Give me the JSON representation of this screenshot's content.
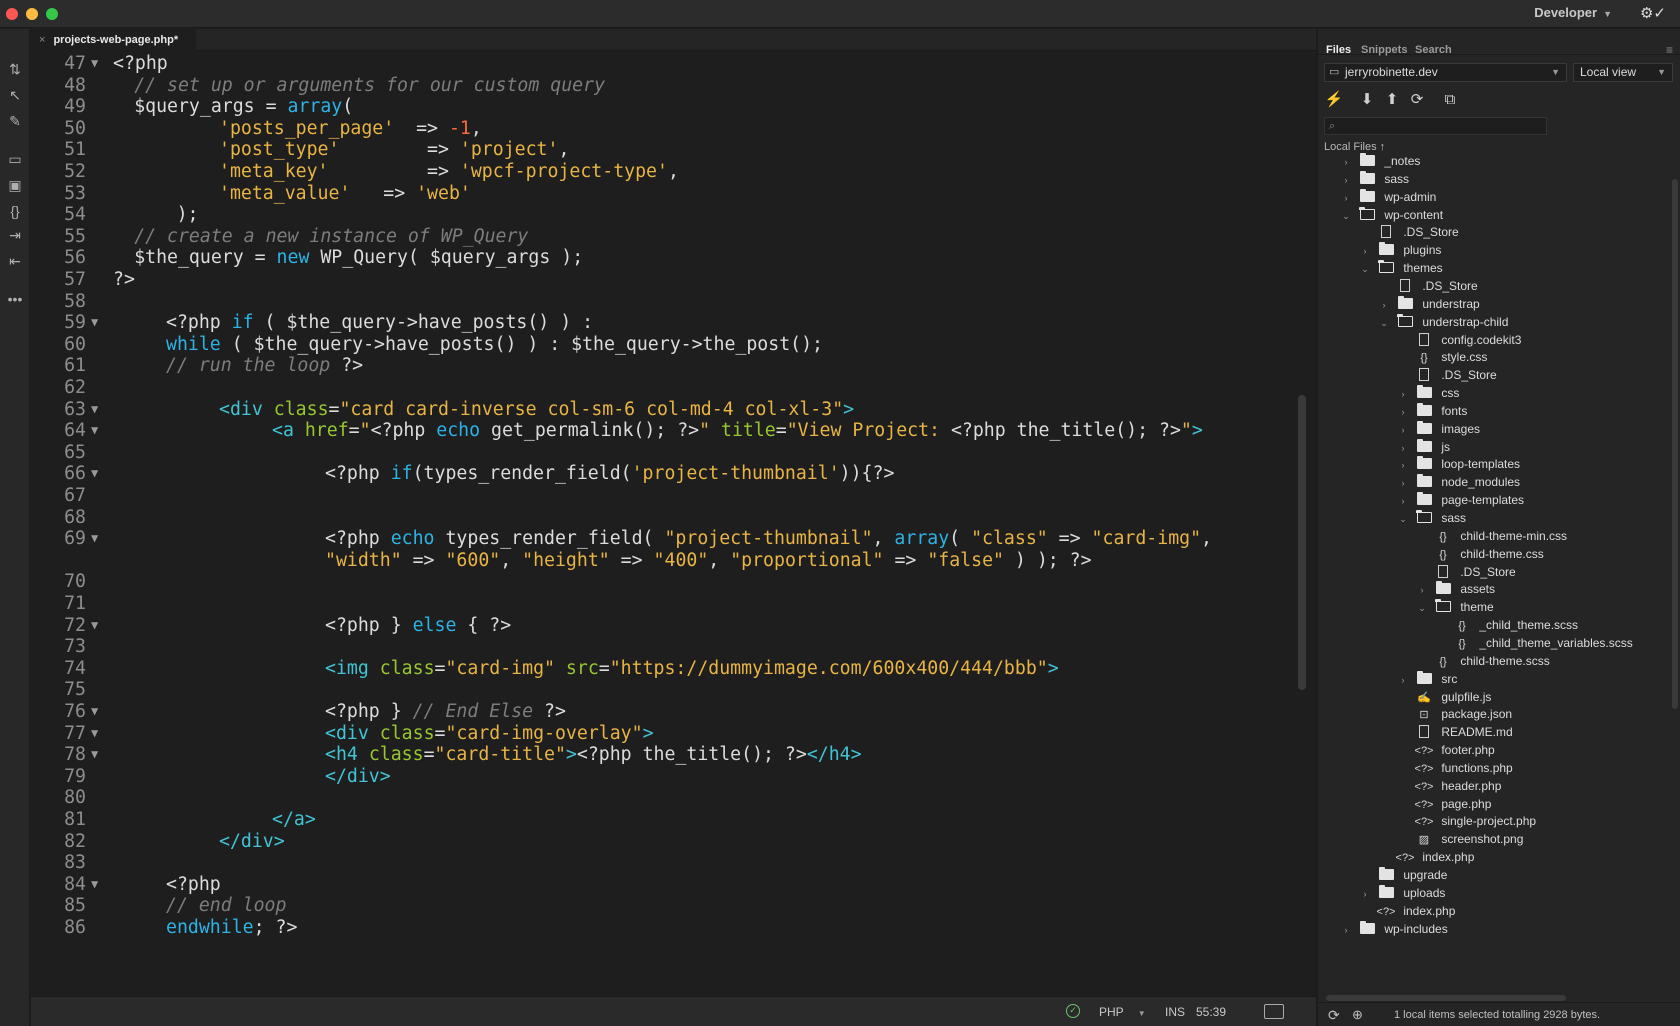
{
  "window": {
    "workspace": "Developer"
  },
  "editor": {
    "tab_title": "projects-web-page.php*",
    "lines": [
      {
        "n": "47",
        "fold": "▼",
        "indent": 0,
        "tokens": [
          [
            "",
            "<?php"
          ]
        ]
      },
      {
        "n": "48",
        "fold": "",
        "indent": 2,
        "tokens": [
          [
            "cm",
            "// set up or arguments for our custom query"
          ]
        ]
      },
      {
        "n": "49",
        "fold": "",
        "indent": 2,
        "tokens": [
          [
            "",
            "$query_args = "
          ],
          [
            "kw",
            "array"
          ],
          [
            "",
            "("
          ]
        ]
      },
      {
        "n": "50",
        "fold": "",
        "indent": 10,
        "tokens": [
          [
            "str",
            "'posts_per_page'"
          ],
          [
            "",
            "  => "
          ],
          [
            "num",
            "-1"
          ],
          [
            "",
            ","
          ]
        ]
      },
      {
        "n": "51",
        "fold": "",
        "indent": 10,
        "tokens": [
          [
            "str",
            "'post_type'"
          ],
          [
            "",
            "        => "
          ],
          [
            "str",
            "'project'"
          ],
          [
            "",
            ","
          ]
        ]
      },
      {
        "n": "52",
        "fold": "",
        "indent": 10,
        "tokens": [
          [
            "str",
            "'meta_key'"
          ],
          [
            "",
            "         => "
          ],
          [
            "str",
            "'wpcf-project-type'"
          ],
          [
            "",
            ","
          ]
        ]
      },
      {
        "n": "53",
        "fold": "",
        "indent": 10,
        "tokens": [
          [
            "str",
            "'meta_value'"
          ],
          [
            "",
            "   => "
          ],
          [
            "str",
            "'web'"
          ]
        ]
      },
      {
        "n": "54",
        "fold": "",
        "indent": 6,
        "tokens": [
          [
            "",
            ");"
          ]
        ]
      },
      {
        "n": "55",
        "fold": "",
        "indent": 2,
        "tokens": [
          [
            "cm",
            "// create a new instance of WP_Query"
          ]
        ]
      },
      {
        "n": "56",
        "fold": "",
        "indent": 2,
        "tokens": [
          [
            "",
            "$the_query = "
          ],
          [
            "kw",
            "new"
          ],
          [
            "",
            " WP_Query( $query_args );"
          ]
        ]
      },
      {
        "n": "57",
        "fold": "",
        "indent": 0,
        "tokens": [
          [
            "",
            "?>"
          ]
        ]
      },
      {
        "n": "58",
        "fold": "",
        "indent": 0,
        "tokens": []
      },
      {
        "n": "59",
        "fold": "▼",
        "indent": 5,
        "tokens": [
          [
            "",
            "<?php "
          ],
          [
            "kw",
            "if"
          ],
          [
            "",
            " ( $the_query->have_posts() ) :"
          ]
        ]
      },
      {
        "n": "60",
        "fold": "",
        "indent": 5,
        "tokens": [
          [
            "kw",
            "while"
          ],
          [
            "",
            " ( $the_query->have_posts() ) : $the_query->the_post();"
          ]
        ]
      },
      {
        "n": "61",
        "fold": "",
        "indent": 5,
        "tokens": [
          [
            "cm",
            "// run the loop"
          ],
          [
            "",
            " ?>"
          ]
        ]
      },
      {
        "n": "62",
        "fold": "",
        "indent": 0,
        "tokens": []
      },
      {
        "n": "63",
        "fold": "▼",
        "indent": 10,
        "tokens": [
          [
            "tag",
            "<div"
          ],
          [
            "",
            " "
          ],
          [
            "attr",
            "class"
          ],
          [
            "",
            "="
          ],
          [
            "str",
            "\"card card-inverse col-sm-6 col-md-4 col-xl-3\""
          ],
          [
            "tag",
            ">"
          ]
        ]
      },
      {
        "n": "64",
        "fold": "▼",
        "indent": 15,
        "tokens": [
          [
            "tag",
            "<a"
          ],
          [
            "",
            " "
          ],
          [
            "attr",
            "href"
          ],
          [
            "",
            "="
          ],
          [
            "str",
            "\""
          ],
          [
            "",
            "<?php "
          ],
          [
            "kw",
            "echo"
          ],
          [
            "",
            " get_permalink(); ?>"
          ],
          [
            "str",
            "\""
          ],
          [
            "",
            " "
          ],
          [
            "attr",
            "title"
          ],
          [
            "",
            "="
          ],
          [
            "str",
            "\"View Project: "
          ],
          [
            "",
            "<?php the_title(); ?>"
          ],
          [
            "str",
            "\""
          ],
          [
            "tag",
            ">"
          ]
        ]
      },
      {
        "n": "65",
        "fold": "",
        "indent": 0,
        "tokens": []
      },
      {
        "n": "66",
        "fold": "▼",
        "indent": 20,
        "tokens": [
          [
            "",
            "<?php "
          ],
          [
            "kw",
            "if"
          ],
          [
            "",
            "(types_render_field("
          ],
          [
            "str",
            "'project-thumbnail'"
          ],
          [
            "",
            ")){?>"
          ]
        ]
      },
      {
        "n": "67",
        "fold": "",
        "indent": 0,
        "tokens": []
      },
      {
        "n": "68",
        "fold": "",
        "indent": 0,
        "tokens": []
      },
      {
        "n": "69",
        "fold": "▼",
        "indent": 20,
        "tokens": [
          [
            "",
            "<?php "
          ],
          [
            "kw",
            "echo"
          ],
          [
            "",
            " types_render_field( "
          ],
          [
            "str",
            "\"project-thumbnail\""
          ],
          [
            "",
            ", "
          ],
          [
            "kw",
            "array"
          ],
          [
            "",
            "( "
          ],
          [
            "str",
            "\"class\""
          ],
          [
            "",
            " => "
          ],
          [
            "str",
            "\"card-img\""
          ],
          [
            "",
            ","
          ]
        ]
      },
      {
        "n": "",
        "fold": "",
        "indent": 20,
        "tokens": [
          [
            "str",
            "\"width\""
          ],
          [
            "",
            " => "
          ],
          [
            "str",
            "\"600\""
          ],
          [
            "",
            ", "
          ],
          [
            "str",
            "\"height\""
          ],
          [
            "",
            " => "
          ],
          [
            "str",
            "\"400\""
          ],
          [
            "",
            ", "
          ],
          [
            "str",
            "\"proportional\""
          ],
          [
            "",
            " => "
          ],
          [
            "str",
            "\"false\""
          ],
          [
            "",
            " ) ); ?>"
          ]
        ]
      },
      {
        "n": "70",
        "fold": "",
        "indent": 0,
        "tokens": []
      },
      {
        "n": "71",
        "fold": "",
        "indent": 0,
        "tokens": []
      },
      {
        "n": "72",
        "fold": "▼",
        "indent": 20,
        "tokens": [
          [
            "",
            "<?php } "
          ],
          [
            "kw",
            "else"
          ],
          [
            "",
            " { ?>"
          ]
        ]
      },
      {
        "n": "73",
        "fold": "",
        "indent": 0,
        "tokens": []
      },
      {
        "n": "74",
        "fold": "",
        "indent": 20,
        "tokens": [
          [
            "tag",
            "<img"
          ],
          [
            "",
            " "
          ],
          [
            "attr",
            "class"
          ],
          [
            "",
            "="
          ],
          [
            "str",
            "\"card-img\""
          ],
          [
            "",
            " "
          ],
          [
            "attr",
            "src"
          ],
          [
            "",
            "="
          ],
          [
            "str",
            "\"https://dummyimage.com/600x400/444/bbb\""
          ],
          [
            "tag",
            ">"
          ]
        ]
      },
      {
        "n": "75",
        "fold": "",
        "indent": 0,
        "tokens": []
      },
      {
        "n": "76",
        "fold": "▼",
        "indent": 20,
        "tokens": [
          [
            "",
            "<?php } "
          ],
          [
            "cm",
            "// End Else"
          ],
          [
            "",
            " ?>"
          ]
        ]
      },
      {
        "n": "77",
        "fold": "▼",
        "indent": 20,
        "tokens": [
          [
            "tag",
            "<div"
          ],
          [
            "",
            " "
          ],
          [
            "attr",
            "class"
          ],
          [
            "",
            "="
          ],
          [
            "str",
            "\"card-img-overlay\""
          ],
          [
            "tag",
            ">"
          ]
        ]
      },
      {
        "n": "78",
        "fold": "▼",
        "indent": 20,
        "tokens": [
          [
            "tag",
            "<h4"
          ],
          [
            "",
            " "
          ],
          [
            "attr",
            "class"
          ],
          [
            "",
            "="
          ],
          [
            "str",
            "\"card-title\""
          ],
          [
            "tag",
            ">"
          ],
          [
            "",
            "<?php the_title(); ?>"
          ],
          [
            "tag",
            "</h4>"
          ]
        ]
      },
      {
        "n": "79",
        "fold": "",
        "indent": 20,
        "tokens": [
          [
            "tag",
            "</div>"
          ]
        ]
      },
      {
        "n": "80",
        "fold": "",
        "indent": 0,
        "tokens": []
      },
      {
        "n": "81",
        "fold": "",
        "indent": 15,
        "tokens": [
          [
            "tag",
            "</a>"
          ]
        ]
      },
      {
        "n": "82",
        "fold": "",
        "indent": 10,
        "tokens": [
          [
            "tag",
            "</div>"
          ]
        ]
      },
      {
        "n": "83",
        "fold": "",
        "indent": 0,
        "tokens": []
      },
      {
        "n": "84",
        "fold": "▼",
        "indent": 5,
        "tokens": [
          [
            "",
            "<?php"
          ]
        ]
      },
      {
        "n": "85",
        "fold": "",
        "indent": 5,
        "tokens": [
          [
            "cm",
            "// end loop"
          ]
        ]
      },
      {
        "n": "86",
        "fold": "",
        "indent": 5,
        "tokens": [
          [
            "kw",
            "endwhile"
          ],
          [
            "",
            "; ?>"
          ]
        ]
      }
    ]
  },
  "statusbar": {
    "language": "PHP",
    "mode": "INS",
    "cursor": "55:39"
  },
  "panel": {
    "tabs": [
      "Files",
      "Snippets",
      "Search"
    ],
    "active_tab": "Files",
    "site": "jerryrobinette.dev",
    "view": "Local view",
    "root_label": "Local Files",
    "status_message": "1 local items selected totalling 2928 bytes.",
    "tree": [
      {
        "name": "_notes",
        "depth": 0,
        "type": "folder",
        "twisty": "›"
      },
      {
        "name": "sass",
        "depth": 0,
        "type": "folder",
        "twisty": "›"
      },
      {
        "name": "wp-admin",
        "depth": 0,
        "type": "folder",
        "twisty": "›"
      },
      {
        "name": "wp-content",
        "depth": 0,
        "type": "folder-open",
        "twisty": "⌄"
      },
      {
        "name": ".DS_Store",
        "depth": 1,
        "type": "file",
        "twisty": ""
      },
      {
        "name": "plugins",
        "depth": 1,
        "type": "folder",
        "twisty": "›"
      },
      {
        "name": "themes",
        "depth": 1,
        "type": "folder-open",
        "twisty": "⌄"
      },
      {
        "name": ".DS_Store",
        "depth": 2,
        "type": "file",
        "twisty": ""
      },
      {
        "name": "understrap",
        "depth": 2,
        "type": "folder",
        "twisty": "›"
      },
      {
        "name": "understrap-child",
        "depth": 2,
        "type": "folder-open",
        "twisty": "⌄"
      },
      {
        "name": "config.codekit3",
        "depth": 3,
        "type": "file",
        "twisty": ""
      },
      {
        "name": "style.css",
        "depth": 3,
        "type": "braces",
        "twisty": ""
      },
      {
        "name": ".DS_Store",
        "depth": 3,
        "type": "file",
        "twisty": ""
      },
      {
        "name": "css",
        "depth": 3,
        "type": "folder",
        "twisty": "›"
      },
      {
        "name": "fonts",
        "depth": 3,
        "type": "folder",
        "twisty": "›"
      },
      {
        "name": "images",
        "depth": 3,
        "type": "folder",
        "twisty": "›"
      },
      {
        "name": "js",
        "depth": 3,
        "type": "folder",
        "twisty": "›"
      },
      {
        "name": "loop-templates",
        "depth": 3,
        "type": "folder",
        "twisty": "›"
      },
      {
        "name": "node_modules",
        "depth": 3,
        "type": "folder",
        "twisty": "›"
      },
      {
        "name": "page-templates",
        "depth": 3,
        "type": "folder",
        "twisty": "›"
      },
      {
        "name": "sass",
        "depth": 3,
        "type": "folder-open",
        "twisty": "⌄"
      },
      {
        "name": "child-theme-min.css",
        "depth": 4,
        "type": "braces",
        "twisty": ""
      },
      {
        "name": "child-theme.css",
        "depth": 4,
        "type": "braces",
        "twisty": ""
      },
      {
        "name": ".DS_Store",
        "depth": 4,
        "type": "file",
        "twisty": ""
      },
      {
        "name": "assets",
        "depth": 4,
        "type": "folder",
        "twisty": "›"
      },
      {
        "name": "theme",
        "depth": 4,
        "type": "folder-open",
        "twisty": "⌄"
      },
      {
        "name": "_child_theme.scss",
        "depth": 5,
        "type": "braces",
        "twisty": ""
      },
      {
        "name": "_child_theme_variables.scss",
        "depth": 5,
        "type": "braces",
        "twisty": ""
      },
      {
        "name": "child-theme.scss",
        "depth": 4,
        "type": "braces",
        "twisty": ""
      },
      {
        "name": "src",
        "depth": 3,
        "type": "folder",
        "twisty": "›"
      },
      {
        "name": "gulpfile.js",
        "depth": 3,
        "type": "script",
        "twisty": ""
      },
      {
        "name": "package.json",
        "depth": 3,
        "type": "json",
        "twisty": ""
      },
      {
        "name": "README.md",
        "depth": 3,
        "type": "file",
        "twisty": ""
      },
      {
        "name": "footer.php",
        "depth": 3,
        "type": "code",
        "twisty": ""
      },
      {
        "name": "functions.php",
        "depth": 3,
        "type": "code",
        "twisty": ""
      },
      {
        "name": "header.php",
        "depth": 3,
        "type": "code",
        "twisty": ""
      },
      {
        "name": "page.php",
        "depth": 3,
        "type": "code",
        "twisty": ""
      },
      {
        "name": "single-project.php",
        "depth": 3,
        "type": "code",
        "twisty": ""
      },
      {
        "name": "screenshot.png",
        "depth": 3,
        "type": "image",
        "twisty": ""
      },
      {
        "name": "index.php",
        "depth": 2,
        "type": "code",
        "twisty": ""
      },
      {
        "name": "upgrade",
        "depth": 1,
        "type": "folder",
        "twisty": ""
      },
      {
        "name": "uploads",
        "depth": 1,
        "type": "folder",
        "twisty": "›"
      },
      {
        "name": "index.php",
        "depth": 1,
        "type": "code",
        "twisty": ""
      },
      {
        "name": "wp-includes",
        "depth": 0,
        "type": "folder",
        "twisty": "›"
      }
    ]
  },
  "colors": {
    "keyword": "#2cb3e6",
    "string": "#e8b443",
    "number": "#ff6a3d",
    "comment": "#7d7d7d",
    "tag": "#40c4d6",
    "attribute": "#98c72e"
  }
}
